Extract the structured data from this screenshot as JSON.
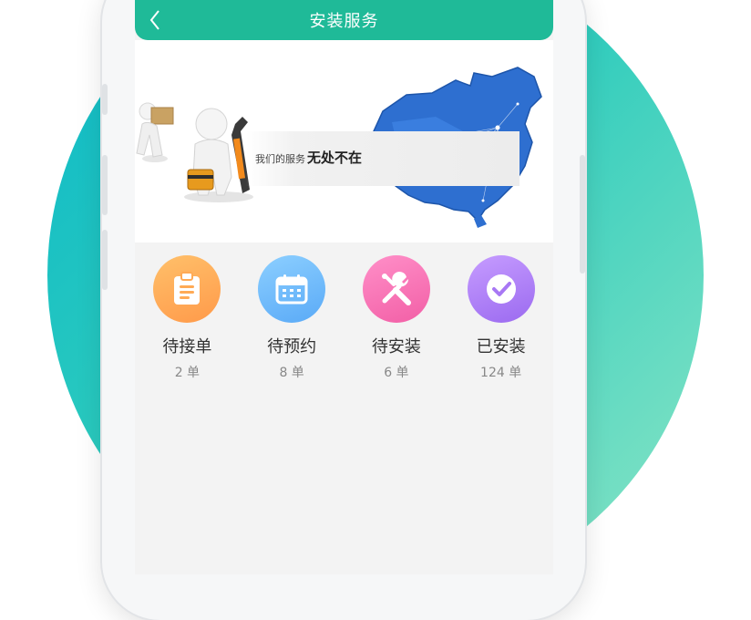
{
  "header": {
    "title": "安装服务"
  },
  "banner": {
    "tagline_prefix": "我们的服务",
    "tagline_emphasis": "无处不在"
  },
  "stats": [
    {
      "label": "待接单",
      "count": "2 单",
      "icon": "clipboard-icon",
      "color_from": "#ffc06a",
      "color_to": "#ff9a4a"
    },
    {
      "label": "待预约",
      "count": "8 单",
      "icon": "calendar-icon",
      "color_from": "#8ccfff",
      "color_to": "#5aaaf7"
    },
    {
      "label": "待安装",
      "count": "6 单",
      "icon": "tools-icon",
      "color_from": "#ff8fc8",
      "color_to": "#f25fa6"
    },
    {
      "label": "已安装",
      "count": "124 单",
      "icon": "check-circle-icon",
      "color_from": "#c69cff",
      "color_to": "#9b6af0"
    }
  ],
  "colors": {
    "header": "#1fba98",
    "background_gradient_from": "#0bb8c9",
    "background_gradient_to": "#8ee6c5"
  }
}
